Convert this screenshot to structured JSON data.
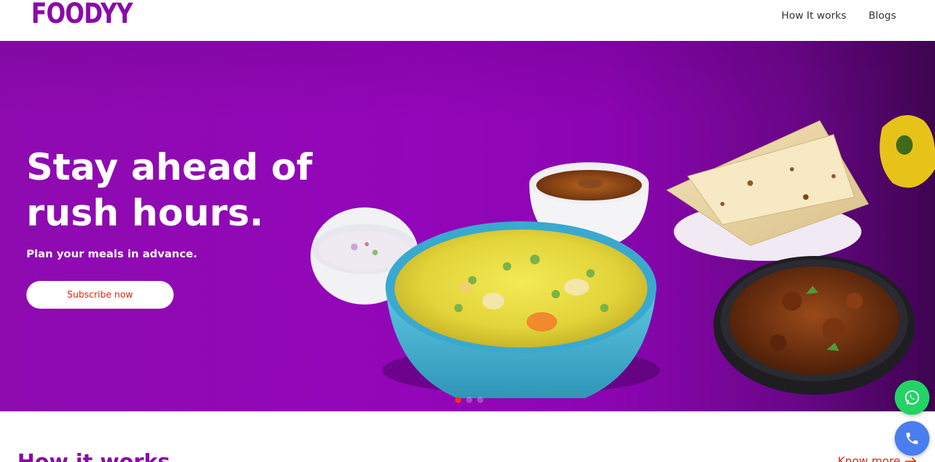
{
  "header": {
    "logo": "FOODYY",
    "nav": [
      {
        "label": "How It works"
      },
      {
        "label": "Blogs"
      }
    ]
  },
  "hero": {
    "headline": "Stay ahead of rush hours.",
    "subtext": "Plan your meals in advance.",
    "cta_label": "Subscribe now",
    "carousel": {
      "slides": 3,
      "active": 1
    }
  },
  "section": {
    "title": "How it works",
    "link_label": "Know more"
  },
  "floating": {
    "whatsapp": "whatsapp-icon",
    "call": "phone-icon"
  },
  "colors": {
    "brand": "#8a0aa8",
    "accent": "#e0250e",
    "whatsapp": "#23d366",
    "call": "#4a7df0"
  }
}
